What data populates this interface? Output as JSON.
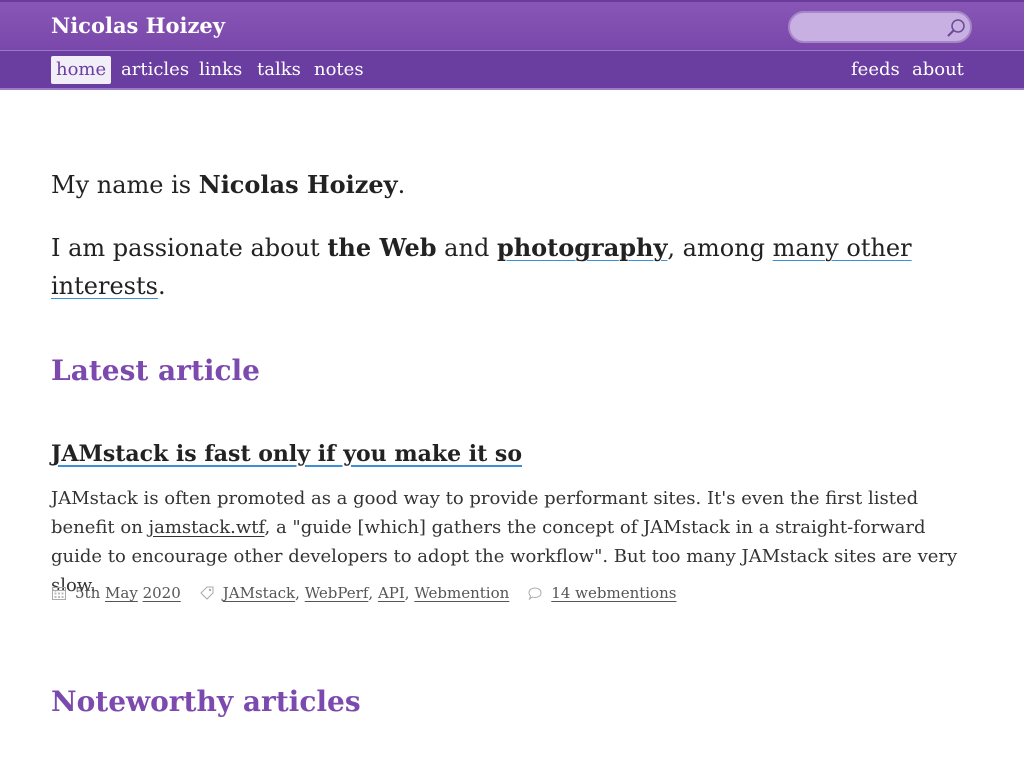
{
  "header": {
    "site_title": "Nicolas Hoizey",
    "search": {
      "placeholder": "",
      "value": ""
    }
  },
  "nav": {
    "left": [
      {
        "label": "home",
        "active": true
      },
      {
        "label": "articles"
      },
      {
        "label": "links"
      },
      {
        "label": "talks"
      },
      {
        "label": "notes"
      }
    ],
    "right": [
      {
        "label": "feeds"
      },
      {
        "label": "about"
      }
    ]
  },
  "intro": {
    "line1_prefix": "My name is ",
    "name": "Nicolas Hoizey",
    "line1_suffix": ".",
    "line2_prefix": "I am passionate about ",
    "topic1": "the Web",
    "and": " and ",
    "topic2": "photography",
    "among": ", among ",
    "other_link": "many other interests",
    "line2_suffix": "."
  },
  "latest": {
    "heading": "Latest article",
    "title": "JAMstack is fast only if you make it so",
    "excerpt_before": "JAMstack is often promoted as a good way to provide performant sites. It's even the first listed benefit on ",
    "excerpt_link": "jamstack.wtf",
    "excerpt_after": ", a \"guide [which] gathers the concept of JAMstack in a straight-forward guide to encourage other developers to adopt the workflow\". But too many JAMstack sites are very slow.",
    "date": {
      "day": "5th",
      "month": "May",
      "year": "2020"
    },
    "tags": [
      "JAMstack",
      "WebPerf",
      "API",
      "Webmention"
    ],
    "webmentions": "14 webmentions"
  },
  "noteworthy": {
    "heading": "Noteworthy articles"
  },
  "colors": {
    "accent": "#7c4aae",
    "nav_bg": "#6a3da0",
    "link_underline": "#3d8fd6"
  },
  "icons": [
    "search-icon",
    "calendar-icon",
    "tag-icon",
    "comment-icon"
  ]
}
